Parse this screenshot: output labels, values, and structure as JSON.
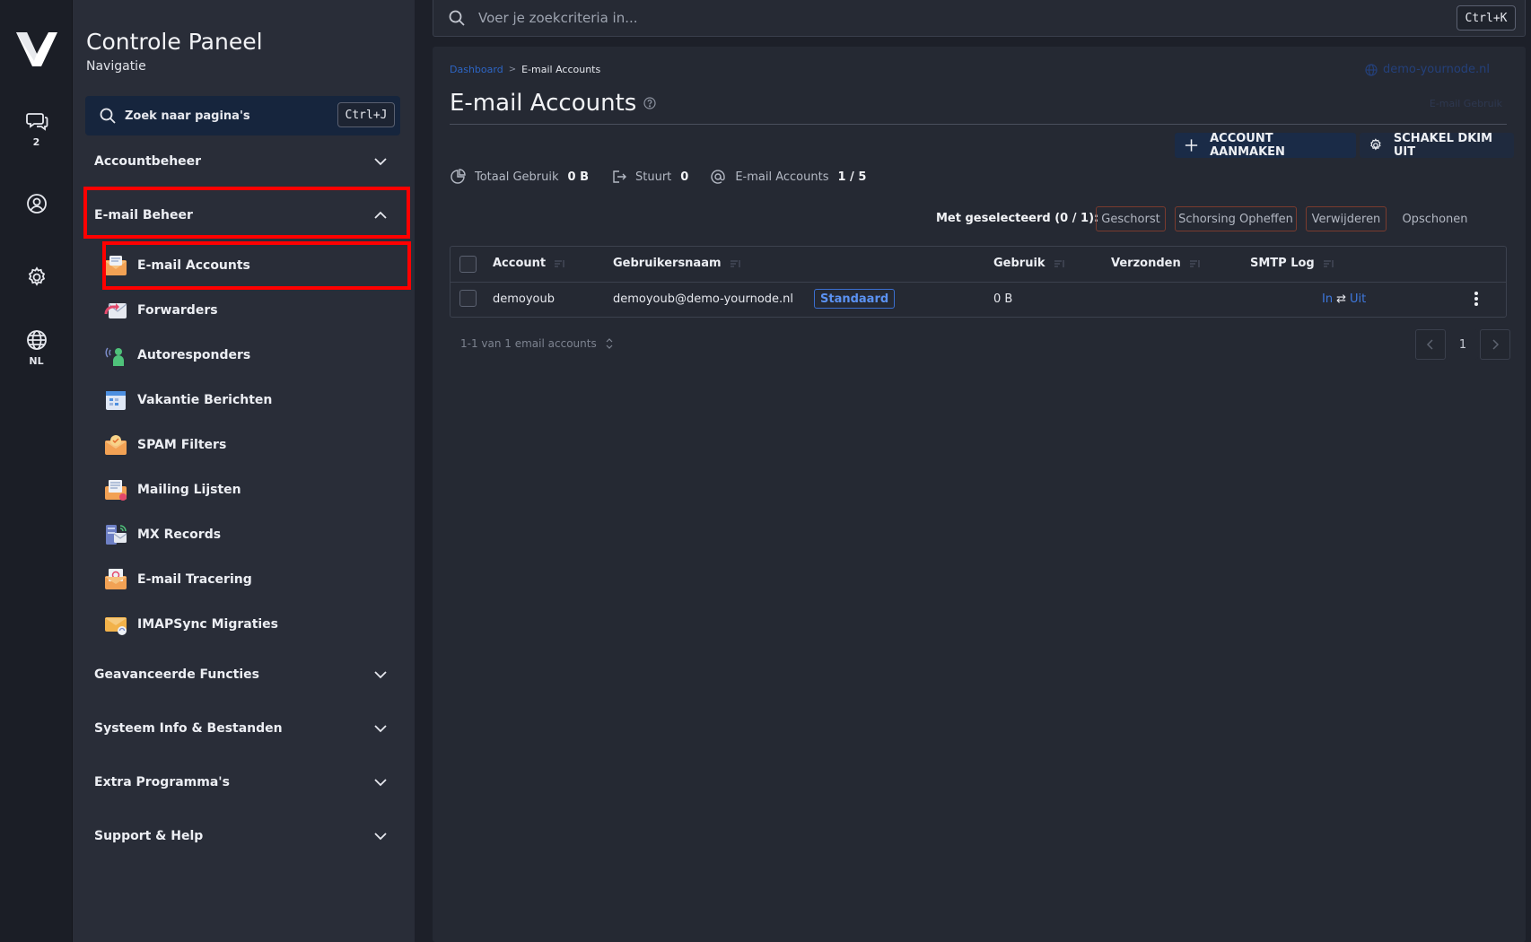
{
  "rail": {
    "chat_badge": "2",
    "language": "NL"
  },
  "sidebar": {
    "title": "Controle Paneel",
    "subtitle": "Navigatie",
    "search_label": "Zoek naar pagina's",
    "search_shortcut": "Ctrl+J",
    "sections": {
      "accountbeheer": "Accountbeheer",
      "email_beheer": "E-mail Beheer",
      "geavanceerde": "Geavanceerde Functies",
      "systeem": "Systeem Info & Bestanden",
      "extra": "Extra Programma's",
      "support": "Support & Help"
    },
    "email_items": [
      {
        "label": "E-mail Accounts",
        "icon": "email-accounts-icon"
      },
      {
        "label": "Forwarders",
        "icon": "forwarders-icon"
      },
      {
        "label": "Autoresponders",
        "icon": "autoresponders-icon"
      },
      {
        "label": "Vakantie Berichten",
        "icon": "vacation-messages-icon"
      },
      {
        "label": "SPAM Filters",
        "icon": "spam-filters-icon"
      },
      {
        "label": "Mailing Lijsten",
        "icon": "mailing-lists-icon"
      },
      {
        "label": "MX Records",
        "icon": "mx-records-icon"
      },
      {
        "label": "E-mail Tracering",
        "icon": "email-tracing-icon"
      },
      {
        "label": "IMAPSync Migraties",
        "icon": "imapsync-icon"
      }
    ]
  },
  "topsearch": {
    "placeholder": "Voer je zoekcriteria in...",
    "shortcut": "Ctrl+K"
  },
  "main": {
    "breadcrumb": [
      "Dashboard",
      "E-mail Accounts"
    ],
    "domain": "demo-yournode.nl",
    "faded_link": "E-mail Gebruik",
    "title": "E-mail Accounts",
    "buttons": {
      "create": "ACCOUNT AANMAKEN",
      "dkim": "SCHAKEL DKIM UIT"
    },
    "stats": {
      "usage_label": "Totaal Gebruik",
      "usage_value": "0 B",
      "sends_label": "Stuurt",
      "sends_value": "0",
      "accounts_label": "E-mail Accounts",
      "accounts_value": "1 / 5"
    },
    "bulk": {
      "label": "Met geselecteerd (0 / 1):",
      "suspend": "Geschorst",
      "unsuspend": "Schorsing Opheffen",
      "delete": "Verwijderen",
      "clean": "Opschonen"
    },
    "table": {
      "columns": [
        "Account",
        "Gebruikersnaam",
        "Gebruik",
        "Verzonden",
        "SMTP Log"
      ],
      "rows": [
        {
          "account": "demoyoub",
          "username": "demoyoub@demo-yournode.nl",
          "badge": "Standaard",
          "usage": "0 B",
          "sent": "",
          "smtp_in": "In",
          "smtp_arrow": "⇄",
          "smtp_out": "Uit"
        }
      ]
    },
    "footer": {
      "info": "1-1 van 1 email accounts",
      "page": "1"
    }
  },
  "colors": {
    "highlight": "#ff0000",
    "accent": "#3e78de",
    "primary_button": "#1a2b47"
  }
}
